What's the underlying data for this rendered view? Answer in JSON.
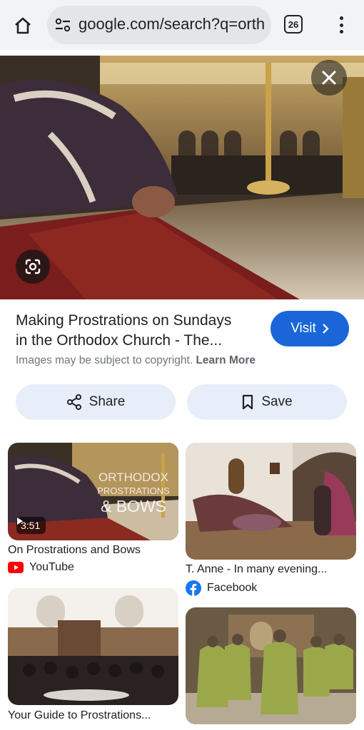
{
  "browser": {
    "url": "google.com/search?q=orth",
    "tab_count": "26"
  },
  "result": {
    "title_line1": "Making Prostrations on Sundays",
    "title_line2": "in the Orthodox Church - The...",
    "visit_label": "Visit",
    "copyright_text": "Images may be subject to copyright.",
    "learn_more": "Learn More",
    "share_label": "Share",
    "save_label": "Save"
  },
  "cards": [
    {
      "title": "On Prostrations and Bows",
      "source": "YouTube",
      "duration": "3:51",
      "overlay_line1": "ORTHODOX",
      "overlay_line2": "PROSTRATIONS",
      "overlay_line3": "& BOWS"
    },
    {
      "title": "T. Anne - In many evening...",
      "source": "Facebook"
    },
    {
      "title": "Your Guide to Prostrations..."
    },
    {
      "title": ""
    }
  ],
  "colors": {
    "accent_blue": "#1a66d9",
    "pill_bg": "#e8eef9",
    "youtube_red": "#ff0000",
    "facebook_blue": "#1877f2"
  }
}
